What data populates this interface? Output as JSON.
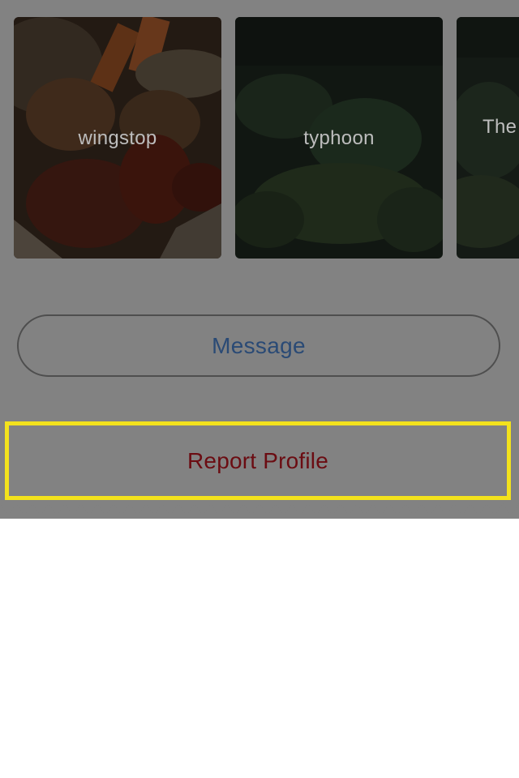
{
  "collections": [
    {
      "label": "wingstop"
    },
    {
      "label": "typhoon"
    },
    {
      "label": "The"
    }
  ],
  "actions": {
    "message_label": "Message",
    "report_label": "Report Profile"
  },
  "colors": {
    "overlay": "#828282",
    "message_text": "#2a4a75",
    "report_text": "#6b0c12",
    "highlight_border": "#f3e21c"
  }
}
